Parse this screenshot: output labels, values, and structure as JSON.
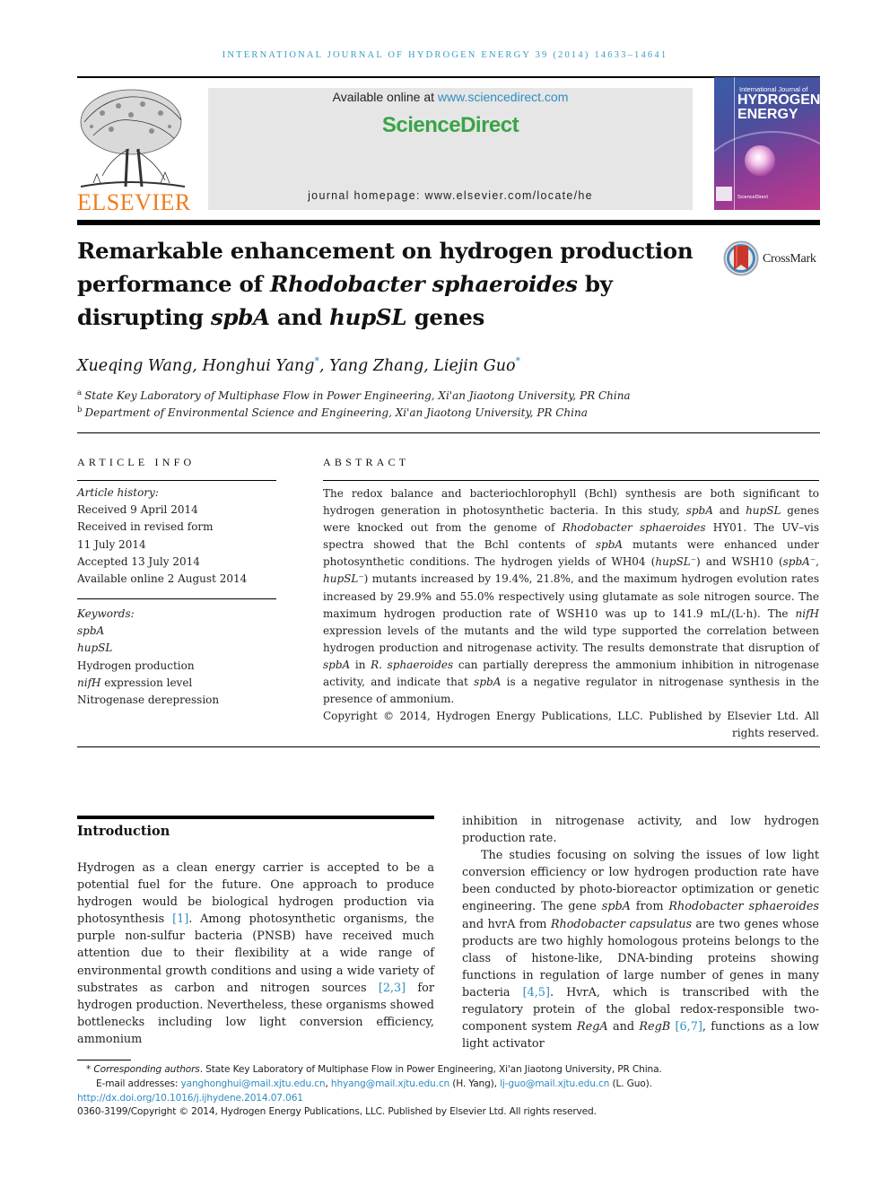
{
  "running_head": "INTERNATIONAL JOURNAL OF HYDROGEN ENERGY 39 (2014) 14633–14641",
  "publisher": {
    "logo_word": "ELSEVIER",
    "available_prefix": "Available online at ",
    "available_link": "www.sciencedirect.com",
    "brand": "ScienceDirect",
    "homepage": "journal homepage: www.elsevier.com/locate/he"
  },
  "cover": {
    "line1": "International Journal of",
    "line2": "HYDROGEN",
    "line3": "ENERGY",
    "footer": "ScienceDirect"
  },
  "colors": {
    "link_blue": "#2f8cc0",
    "sciencedirect_green": "#3aa346",
    "elsevier_orange": "#f07b1b",
    "banner_gray": "#e6e6e6"
  },
  "crossmark_label": "CrossMark",
  "title": {
    "line1": "Remarkable enhancement on hydrogen production",
    "line2_pre": "performance of ",
    "line2_italic": "Rhodobacter sphaeroides",
    "line2_post": " by",
    "line3_pre": "disrupting ",
    "line3_it1": "spbA",
    "line3_mid": " and ",
    "line3_it2": "hupSL",
    "line3_post": " genes"
  },
  "authors": [
    {
      "name": "Xueqing Wang",
      "mark": ""
    },
    {
      "name": "Honghui Yang",
      "mark": "*"
    },
    {
      "name": "Yang Zhang",
      "mark": ""
    },
    {
      "name": "Liejin Guo",
      "mark": "*"
    }
  ],
  "affiliations": [
    {
      "mark": "a",
      "text": "State Key Laboratory of Multiphase Flow in Power Engineering, Xi'an Jiaotong University, PR China"
    },
    {
      "mark": "b",
      "text": "Department of Environmental Science and Engineering, Xi'an Jiaotong University, PR China"
    }
  ],
  "article_info": {
    "heading": "ARTICLE INFO",
    "history_label": "Article history:",
    "history": [
      "Received 9 April 2014",
      "Received in revised form",
      "11 July 2014",
      "Accepted 13 July 2014",
      "Available online 2 August 2014"
    ],
    "keywords_label": "Keywords:",
    "keywords": [
      {
        "text": "spbA",
        "italic": true
      },
      {
        "text": "hupSL",
        "italic": true
      },
      {
        "text": "Hydrogen production",
        "italic": false
      },
      {
        "italic_part": "nifH",
        "text": " expression level"
      },
      {
        "text": "Nitrogenase derepression",
        "italic": false
      }
    ]
  },
  "abstract": {
    "heading": "ABSTRACT",
    "s1": "The redox balance and bacteriochlorophyll (Bchl) synthesis are both significant to hydrogen generation in photosynthetic bacteria. In this study, ",
    "s1_i1": "spbA",
    "s1_m1": " and ",
    "s1_i2": "hupSL",
    "s1_m2": " genes were knocked out from the genome of ",
    "s1_i3": "Rhodobacter sphaeroides",
    "s1_m3": " HY01. The UV–vis spectra showed that the Bchl contents of ",
    "s1_i4": "spbA",
    "s1_m4": " mutants were enhanced under photosynthetic conditions. The hydrogen yields of WH04 (",
    "s1_i5": "hupSL⁻",
    "s1_m5": ") and WSH10 (",
    "s1_i6": "spbA⁻",
    "s1_m6": ", ",
    "s1_i7": "hupSL⁻",
    "s1_m7": ") mutants increased by 19.4%, 21.8%, and the maximum hydrogen evolution rates increased by 29.9% and 55.0% respectively using glutamate as sole nitrogen source. The maximum hydrogen production rate of WSH10 was up to 141.9 mL/(L·h). The ",
    "s1_i8": "nifH",
    "s1_m8": " expression levels of the mutants and the wild type supported the correlation between hydrogen production and nitrogenase activity. The results demonstrate that disruption of ",
    "s1_i9": "spbA",
    "s1_m9": " in ",
    "s1_i10": "R. sphaeroides",
    "s1_m10": " can partially derepress the ammonium inhibition in nitrogenase activity, and indicate that ",
    "s1_i11": "spbA",
    "s1_m11": " is a negative regulator in nitrogenase synthesis in the presence of ammonium.",
    "copyright": "Copyright © 2014, Hydrogen Energy Publications, LLC. Published by Elsevier Ltd. All rights reserved."
  },
  "introduction": {
    "heading": "Introduction",
    "left": {
      "p1": "Hydrogen as a clean energy carrier is accepted to be a potential fuel for the future. One approach to produce hydrogen would be biological hydrogen production via photosynthesis ",
      "ref1": "[1]",
      "p2": ". Among photosynthetic organisms, the purple non-sulfur bacteria (PNSB) have received much attention due to their flexibility at a wide range of environmental growth conditions and using a wide variety of substrates as carbon and nitrogen sources ",
      "ref2": "[2,3]",
      "p3": " for hydrogen production. Nevertheless, these organisms showed bottlenecks including low light conversion efficiency, ammonium"
    },
    "right": {
      "cont": "inhibition in nitrogenase activity, and low hydrogen production rate.",
      "p1": "The studies focusing on solving the issues of low light conversion efficiency or low hydrogen production rate have been conducted by photo-bioreactor optimization or genetic engineering. The gene ",
      "i1": "spbA",
      "m1": " from ",
      "i2": "Rhodobacter sphaeroides",
      "m2": " and hvrA from ",
      "i3": "Rhodobacter capsulatus",
      "m3": " are two genes whose products are two highly homologous proteins belongs to the class of histone-like, DNA-binding proteins showing functions in regulation of large number of genes in many bacteria ",
      "ref1": "[4,5]",
      "m4": ". HvrA, which is transcribed with the regulatory protein of the global redox-responsible two-component system ",
      "i4": "RegA",
      "m5": " and ",
      "i5": "RegB",
      "m6": " ",
      "ref2": "[6,7]",
      "m7": ", functions as a low light activator"
    }
  },
  "footnotes": {
    "star": "*",
    "corr_label": "Corresponding authors",
    "corr_text": ". State Key Laboratory of Multiphase Flow in Power Engineering, Xi'an Jiaotong University, PR China.",
    "email_label": "E-mail addresses: ",
    "email1": "yanghonghui@mail.xjtu.edu.cn",
    "sep1": ", ",
    "email2": "hhyang@mail.xjtu.edu.cn",
    "who2": " (H. Yang), ",
    "email3": "lj-guo@mail.xjtu.edu.cn",
    "who3": " (L. Guo).",
    "doi": "http://dx.doi.org/10.1016/j.ijhydene.2014.07.061",
    "issn_copyright": "0360-3199/Copyright © 2014, Hydrogen Energy Publications, LLC. Published by Elsevier Ltd. All rights reserved."
  }
}
